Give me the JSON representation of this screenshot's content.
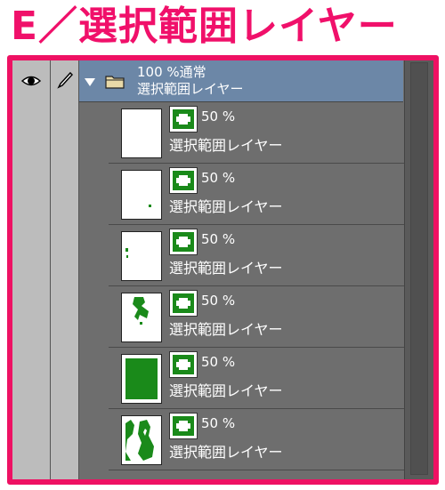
{
  "heading": "E／選択範囲レイヤー",
  "folder": {
    "opacity_mode": "100 %通常",
    "name": "選択範囲レイヤー"
  },
  "layers": [
    {
      "opacity": "50 %",
      "name": "選択範囲レイヤー"
    },
    {
      "opacity": "50 %",
      "name": "選択範囲レイヤー"
    },
    {
      "opacity": "50 %",
      "name": "選択範囲レイヤー"
    },
    {
      "opacity": "50 %",
      "name": "選択範囲レイヤー"
    },
    {
      "opacity": "50 %",
      "name": "選択範囲レイヤー"
    },
    {
      "opacity": "50 %",
      "name": "選択範囲レイヤー"
    }
  ],
  "colors": {
    "accent": "#ee1163",
    "panel": "#6e6e6e",
    "selected_row": "#6c87a7",
    "mask_green": "#1a8a1a"
  },
  "icons": [
    "eye-icon",
    "pen-icon",
    "expand-arrow-icon",
    "folder-icon",
    "layer-mask-icon"
  ]
}
